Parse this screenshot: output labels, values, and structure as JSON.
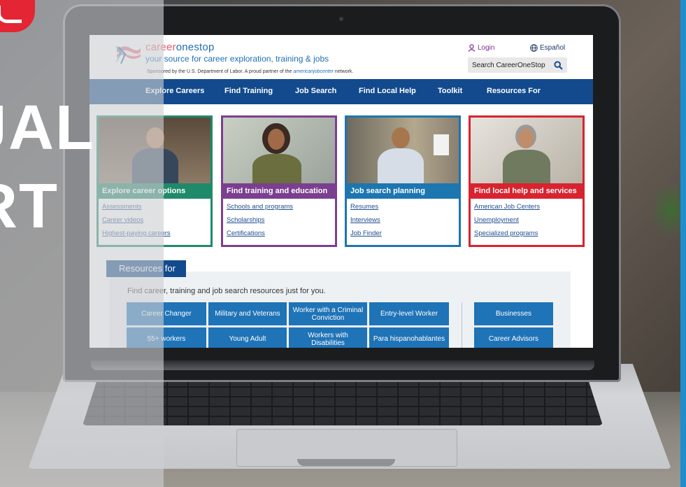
{
  "site": {
    "logo_career": "career",
    "logo_onestop": "onestop",
    "tagline": "your source for career exploration, training & jobs",
    "sponsor_prefix": "Sponsored by the U.S. Department of Labor. A proud partner of the",
    "sponsor_partner": "americanjobcenter",
    "sponsor_suffix": "network.",
    "login_label": "Login",
    "espanol_label": "Español",
    "search_label": "Search CareerOneStop"
  },
  "nav": {
    "items": [
      {
        "label": "Explore Careers"
      },
      {
        "label": "Find Training"
      },
      {
        "label": "Job Search"
      },
      {
        "label": "Find Local Help"
      },
      {
        "label": "Toolkit"
      },
      {
        "label": "Resources For"
      }
    ]
  },
  "cards": [
    {
      "title": "Explore career options",
      "color": "#1f8a6a",
      "links": [
        "Assessments",
        "Career videos",
        "Highest-paying careers"
      ]
    },
    {
      "title": "Find training and education",
      "color": "#7b3f8f",
      "links": [
        "Schools and programs",
        "Scholarships",
        "Certifications"
      ]
    },
    {
      "title": "Job search planning",
      "color": "#1c76b0",
      "links": [
        "Resumes",
        "Interviews",
        "Job Finder"
      ]
    },
    {
      "title": "Find local help and services",
      "color": "#d9232f",
      "links": [
        "American Job Centers",
        "Unemployment",
        "Specialized programs"
      ]
    }
  ],
  "resources": {
    "tab_label": "Resources for",
    "intro": "Find career, training and job search resources just for you.",
    "buttons": [
      "Career Changer",
      "Military and Veterans",
      "Worker with a Criminal Conviction",
      "Entry-level Worker",
      "Businesses",
      "55+ workers",
      "Young Adult",
      "Workers with Disabilities",
      "Para hispanohablantes",
      "Career Advisors"
    ]
  },
  "overlay": {
    "line1": "JAL",
    "line2": "RT"
  }
}
